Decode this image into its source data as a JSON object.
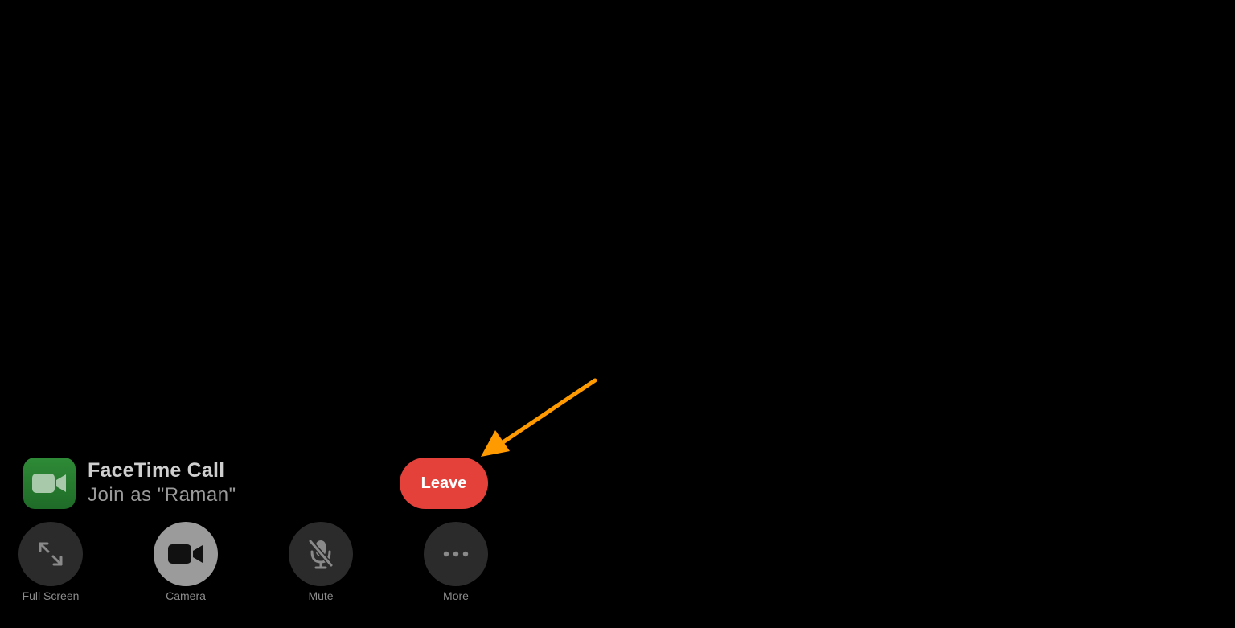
{
  "call": {
    "title": "FaceTime Call",
    "subtitle": "Join as \"Raman\"",
    "app_icon": "facetime-app-icon"
  },
  "leave_button": {
    "label": "Leave",
    "color": "#e3413a"
  },
  "controls": [
    {
      "label": "Full Screen",
      "icon": "expand-arrows-icon"
    },
    {
      "label": "Camera",
      "icon": "video-camera-icon",
      "active": true
    },
    {
      "label": "Mute",
      "icon": "microphone-slash-icon"
    },
    {
      "label": "More",
      "icon": "ellipsis-icon"
    }
  ],
  "annotation": {
    "arrow_color": "#ff9a00"
  }
}
